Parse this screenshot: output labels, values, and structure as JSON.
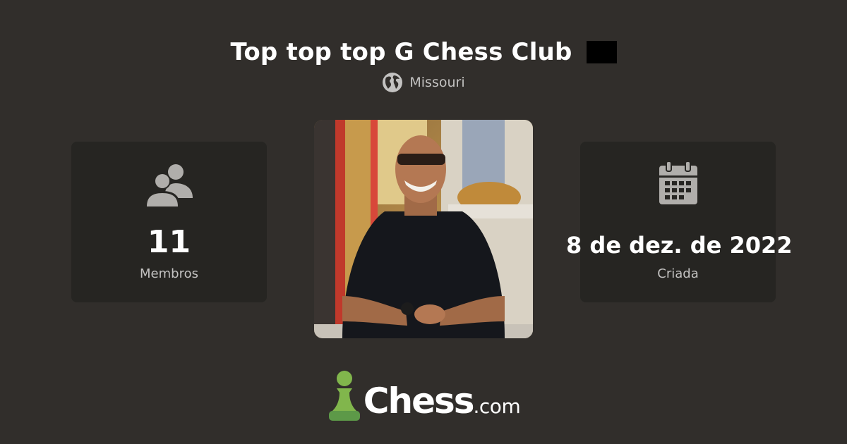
{
  "club": {
    "title": "Top top top G Chess Club",
    "location": "Missouri",
    "flag_color": "#000000"
  },
  "stats": {
    "members": {
      "value": "11",
      "label": "Membros",
      "icon": "members-icon"
    },
    "created": {
      "value": "8 de dez. de 2022",
      "label": "Criada",
      "icon": "calendar-icon"
    }
  },
  "avatar": {
    "icon": "club-avatar-photo"
  },
  "brand": {
    "name": "Chess",
    "suffix": ".com",
    "icon": "pawn-icon",
    "accent": "#81b64c"
  },
  "colors": {
    "background": "#312e2b",
    "card": "#262522",
    "muted_text": "#c3c2c1",
    "icon": "#b0aeab"
  }
}
